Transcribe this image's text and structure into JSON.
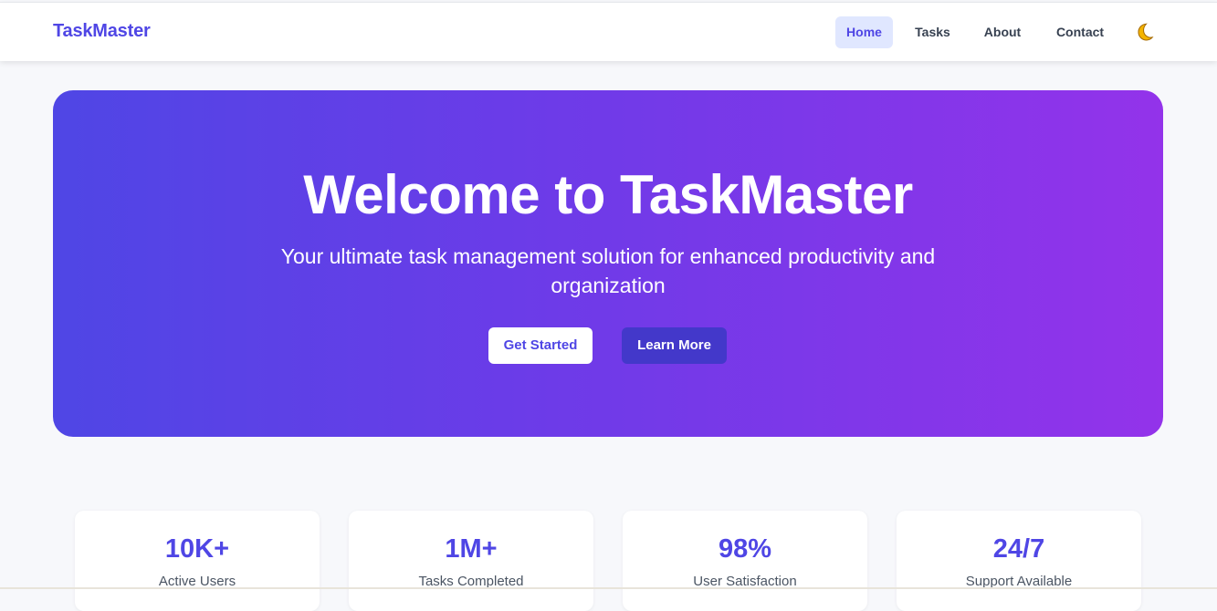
{
  "navbar": {
    "brand": "TaskMaster",
    "links": [
      {
        "label": "Home",
        "active": true
      },
      {
        "label": "Tasks",
        "active": false
      },
      {
        "label": "About",
        "active": false
      },
      {
        "label": "Contact",
        "active": false
      }
    ],
    "theme_toggle_icon": "moon-icon"
  },
  "hero": {
    "title": "Welcome to TaskMaster",
    "subtitle": "Your ultimate task management solution for enhanced productivity and organization",
    "primary_button": "Get Started",
    "secondary_button": "Learn More"
  },
  "stats": [
    {
      "value": "10K+",
      "label": "Active Users"
    },
    {
      "value": "1M+",
      "label": "Tasks Completed"
    },
    {
      "value": "98%",
      "label": "User Satisfaction"
    },
    {
      "value": "24/7",
      "label": "Support Available"
    }
  ],
  "colors": {
    "accent": "#4f46e5",
    "gradient_start": "#4f46e5",
    "gradient_end": "#9333ea",
    "secondary_button": "#4338ca"
  }
}
